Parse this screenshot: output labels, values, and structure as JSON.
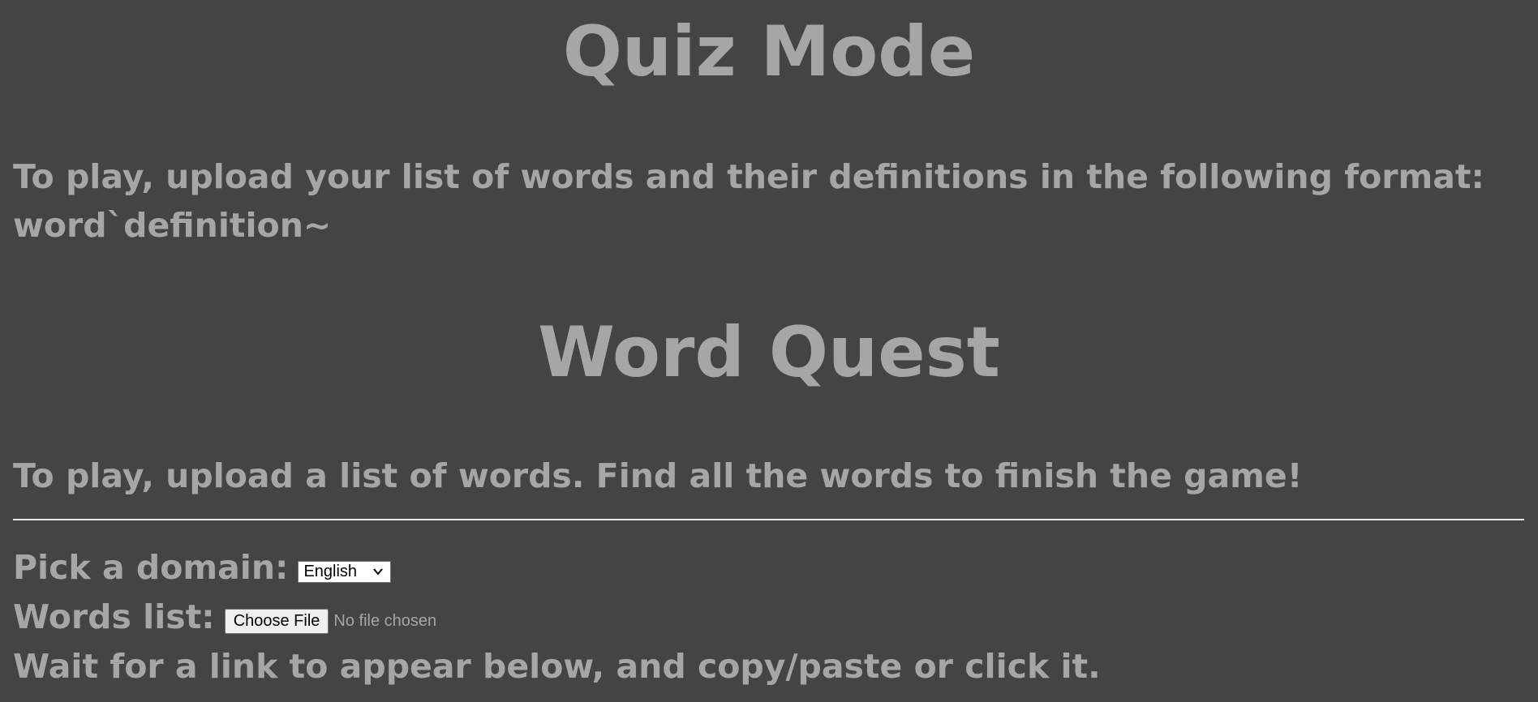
{
  "quiz": {
    "title": "Quiz Mode",
    "description": "To play, upload your list of words and their definitions in the following format:",
    "format": "word`definition~"
  },
  "word_quest": {
    "title": "Word Quest",
    "description": "To play, upload a list of words. Find all the words to finish the game!"
  },
  "form": {
    "domain_label": "Pick a domain:",
    "domain_selected": "English",
    "words_label": "Words list:",
    "choose_file_label": "Choose File",
    "file_status": "No file chosen",
    "wait_message": "Wait for a link to appear below, and copy/paste or click it."
  },
  "colors": {
    "background": "#444444",
    "text": "#a6a6a6",
    "divider": "#e9e9e9"
  },
  "icons": {
    "select_arrow": "chevron-down-icon"
  }
}
